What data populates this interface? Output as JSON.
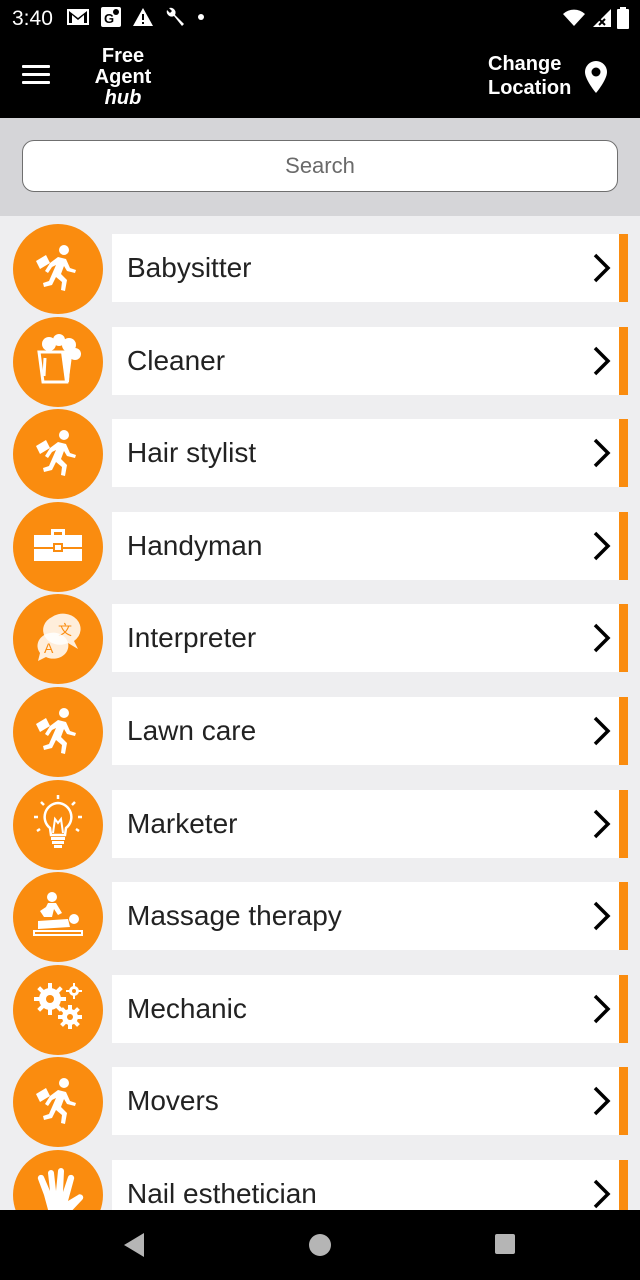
{
  "status": {
    "time": "3:40",
    "icons_left": [
      "gmail-icon",
      "maps-icon",
      "warning-icon",
      "wrench-icon",
      "dot-icon"
    ],
    "icons_right": [
      "wifi-icon",
      "signal-icon",
      "battery-icon"
    ]
  },
  "app_bar": {
    "logo": {
      "line1": "Free",
      "line2": "Agent",
      "line3": "hub"
    },
    "change_location": {
      "line1": "Change",
      "line2": "Location"
    }
  },
  "search": {
    "placeholder": "Search"
  },
  "categories": [
    {
      "label": "Babysitter",
      "icon": "running-person-icon"
    },
    {
      "label": "Cleaner",
      "icon": "bucket-icon"
    },
    {
      "label": "Hair stylist",
      "icon": "running-person-icon"
    },
    {
      "label": "Handyman",
      "icon": "toolbox-icon"
    },
    {
      "label": "Interpreter",
      "icon": "translate-bubbles-icon"
    },
    {
      "label": "Lawn care",
      "icon": "running-person-icon"
    },
    {
      "label": "Marketer",
      "icon": "lightbulb-icon"
    },
    {
      "label": "Massage therapy",
      "icon": "massage-icon"
    },
    {
      "label": "Mechanic",
      "icon": "gears-icon"
    },
    {
      "label": "Movers",
      "icon": "running-person-icon"
    },
    {
      "label": "Nail esthetician",
      "icon": "hand-icon"
    }
  ],
  "colors": {
    "accent": "#fa8c0f",
    "bar": "#000000",
    "background": "#eeeef0"
  },
  "nav": [
    "back-icon",
    "home-icon",
    "recents-icon"
  ]
}
